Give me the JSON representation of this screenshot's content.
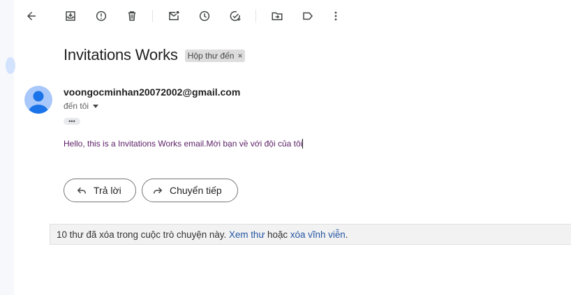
{
  "toolbar": {
    "icons": [
      "back-icon",
      "archive-icon",
      "report-spam-icon",
      "delete-icon",
      "mark-unread-icon",
      "snooze-icon",
      "add-to-tasks-icon",
      "move-to-icon",
      "label-icon",
      "more-icon"
    ]
  },
  "email": {
    "subject": "Invitations Works",
    "label_chip": "Hộp thư đến",
    "label_remove": "×",
    "sender": "voongocminhan20072002@gmail.com",
    "to": "đến tôi",
    "ellipsis": "•••",
    "body": "Hello, this is a Invitations Works email.Mời bạn về với đội của tôi"
  },
  "actions": {
    "reply_label": "Trả lời",
    "forward_label": "Chuyển tiếp"
  },
  "notice": {
    "text_before": "10 thư đã xóa trong cuộc trò chuyện này. ",
    "view_link": "Xem thư",
    "text_middle": " hoặc ",
    "delete_link": "xóa vĩnh viễn",
    "text_after": "."
  },
  "colors": {
    "body_text": "#5b1e66",
    "link": "#2455a4",
    "avatar_bg": "#a8c7fa",
    "avatar_fg": "#1a73e8"
  }
}
